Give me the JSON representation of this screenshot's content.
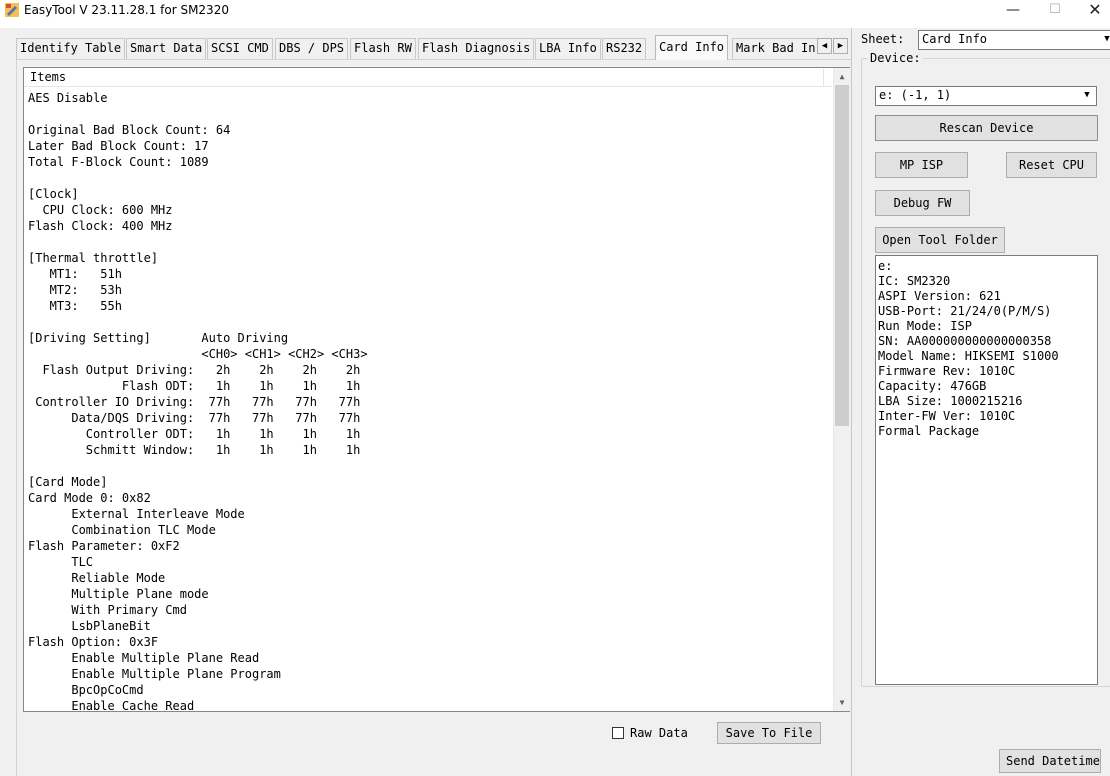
{
  "window": {
    "title": "EasyTool  V 23.11.28.1   for SM2320",
    "minimize": "—",
    "maximize": "☐",
    "close": "✕"
  },
  "tabs": [
    {
      "label": "Identify Table",
      "active": false
    },
    {
      "label": "Smart Data",
      "active": false
    },
    {
      "label": "SCSI CMD",
      "active": false
    },
    {
      "label": "DBS / DPS",
      "active": false
    },
    {
      "label": "Flash RW",
      "active": false
    },
    {
      "label": "Flash Diagnosis",
      "active": false
    },
    {
      "label": "LBA Info",
      "active": false
    },
    {
      "label": "RS232",
      "active": false
    },
    {
      "label": "Card Info",
      "active": true
    },
    {
      "label": "Mark Bad In",
      "active": false
    }
  ],
  "tab_scroll": {
    "left": "◀",
    "right": "▶"
  },
  "list": {
    "header": "Items",
    "lines": [
      "AES Disable",
      "",
      "Original Bad Block Count: 64",
      "Later Bad Block Count: 17",
      "Total F-Block Count: 1089",
      "",
      "[Clock]",
      "  CPU Clock: 600 MHz",
      "Flash Clock: 400 MHz",
      "",
      "[Thermal throttle]",
      "   MT1:   51h",
      "   MT2:   53h",
      "   MT3:   55h",
      "",
      "[Driving Setting]       Auto Driving",
      "                        <CH0> <CH1> <CH2> <CH3>",
      "  Flash Output Driving:   2h    2h    2h    2h",
      "             Flash ODT:   1h    1h    1h    1h",
      " Controller IO Driving:  77h   77h   77h   77h",
      "      Data/DQS Driving:  77h   77h   77h   77h",
      "        Controller ODT:   1h    1h    1h    1h",
      "        Schmitt Window:   1h    1h    1h    1h",
      "",
      "[Card Mode]",
      "Card Mode 0: 0x82",
      "      External Interleave Mode",
      "      Combination TLC Mode",
      "Flash Parameter: 0xF2",
      "      TLC",
      "      Reliable Mode",
      "      Multiple Plane mode",
      "      With Primary Cmd",
      "      LsbPlaneBit",
      "Flash Option: 0x3F",
      "      Enable Multiple Plane Read",
      "      Enable Multiple Plane Program",
      "      BpcOpCoCmd",
      "      Enable Cache Read"
    ],
    "scroll_up": "▲",
    "scroll_down": "▼"
  },
  "bottom": {
    "raw_data_label": "Raw Data",
    "raw_data_checked": false,
    "save_label": "Save To File"
  },
  "sidebar": {
    "sheet_label": "Sheet:",
    "sheet_value": "Card Info",
    "device_group": "Device:",
    "device_value": "e: (-1, 1)",
    "combo_arrow": "▼",
    "rescan_label": "Rescan Device",
    "mp_isp_label": "MP ISP",
    "reset_cpu_label": "Reset CPU",
    "debug_fw_label": "Debug FW",
    "open_folder_label": "Open Tool Folder",
    "info_lines": [
      "e:",
      "IC: SM2320",
      "ASPI Version: 621",
      "USB-Port: 21/24/0(P/M/S)",
      "Run Mode: ISP",
      "SN: AA000000000000000358",
      "Model Name: HIKSEMI S1000",
      "Firmware Rev: 1010C",
      "Capacity: 476GB",
      "LBA Size: 1000215216",
      "Inter-FW Ver: 1010C",
      "Formal Package"
    ],
    "send_datetime_label": "Send Datetime"
  }
}
